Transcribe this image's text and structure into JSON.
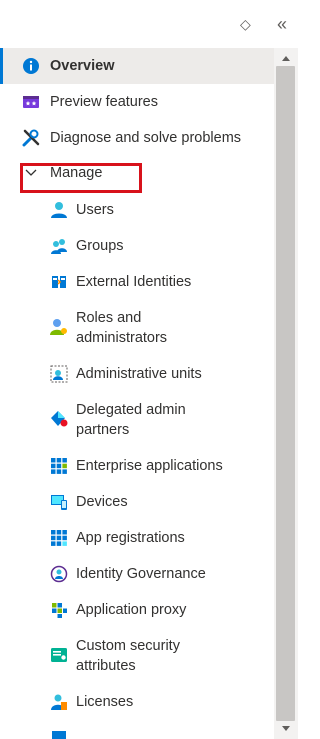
{
  "toolbar": {
    "pin_glyph": "◇",
    "collapse_glyph": "«"
  },
  "nav": {
    "overview": "Overview",
    "preview_features": "Preview features",
    "diagnose": "Diagnose and solve problems",
    "manage": "Manage",
    "items": [
      {
        "label": "Users",
        "icon": "user-icon"
      },
      {
        "label": "Groups",
        "icon": "groups-icon"
      },
      {
        "label": "External Identities",
        "icon": "external-identities-icon"
      },
      {
        "label": "Roles and\nadministrators",
        "icon": "roles-icon"
      },
      {
        "label": "Administrative units",
        "icon": "admin-units-icon"
      },
      {
        "label": "Delegated admin\npartners",
        "icon": "delegated-admin-icon"
      },
      {
        "label": "Enterprise applications",
        "icon": "enterprise-apps-icon"
      },
      {
        "label": "Devices",
        "icon": "devices-icon"
      },
      {
        "label": "App registrations",
        "icon": "app-registrations-icon"
      },
      {
        "label": "Identity Governance",
        "icon": "identity-governance-icon"
      },
      {
        "label": "Application proxy",
        "icon": "application-proxy-icon"
      },
      {
        "label": "Custom security\nattributes",
        "icon": "custom-attributes-icon"
      },
      {
        "label": "Licenses",
        "icon": "licenses-icon"
      }
    ]
  },
  "colors": {
    "accent": "#0078d4",
    "selected_bg": "#edebe9",
    "highlight_box": "#d8121b"
  }
}
